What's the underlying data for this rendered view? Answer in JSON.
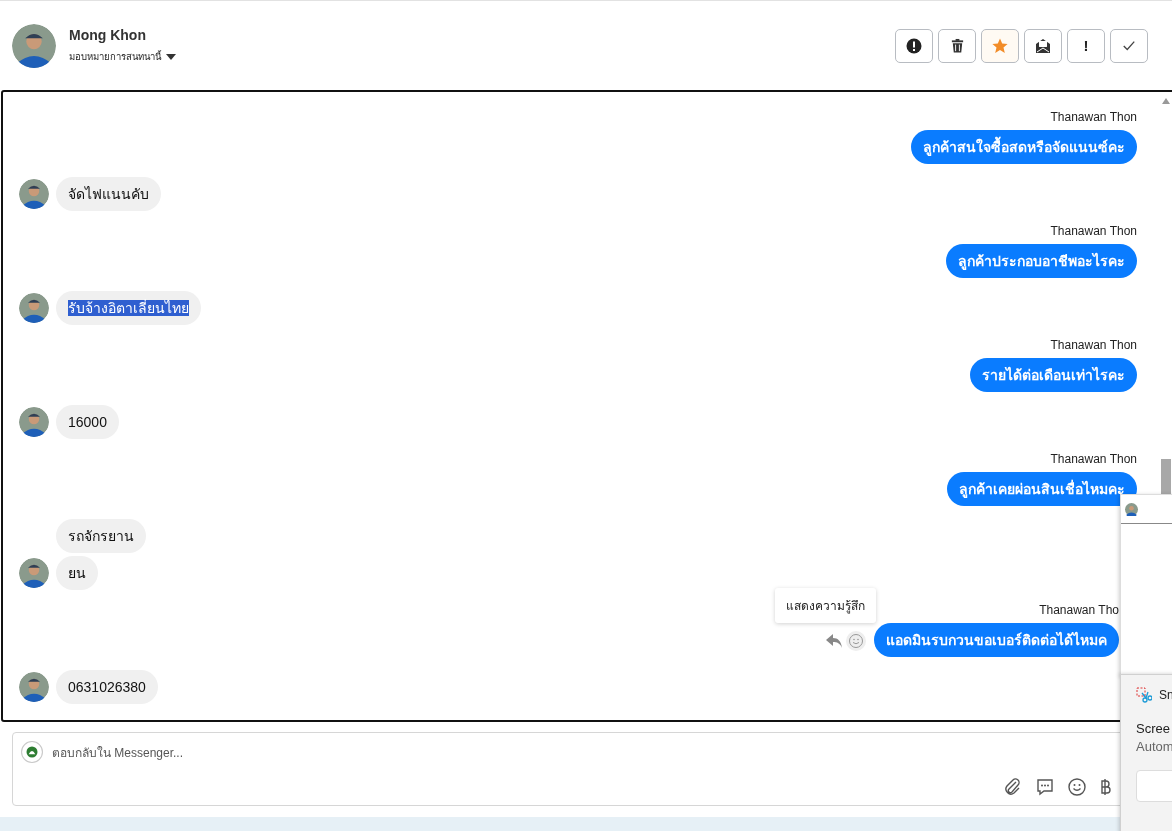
{
  "header": {
    "name": "Mong Khon",
    "assign_label": "มอบหมายการสนทนานี้"
  },
  "toolbar": [
    {
      "kind": "alert",
      "selected": false
    },
    {
      "kind": "trash",
      "selected": false
    },
    {
      "kind": "star",
      "selected": true
    },
    {
      "kind": "mail",
      "selected": false
    },
    {
      "kind": "exclaim",
      "text": "!",
      "selected": false
    },
    {
      "kind": "check",
      "selected": false
    }
  ],
  "messages": [
    {
      "kind": "outgoing",
      "sender": "Thanawan Thon",
      "text": "ลูกค้าสนใจซื้อสดหรือจัดแนนซ์คะ"
    },
    {
      "kind": "incoming",
      "text": "จัดไฟแนนคับ",
      "avatar": true,
      "selected": false
    },
    {
      "kind": "outgoing",
      "sender": "Thanawan Thon",
      "text": "ลูกค้าประกอบอาชีพอะไรคะ"
    },
    {
      "kind": "incoming",
      "text": "รับจ้างอิตาเลี่ยนไทย",
      "avatar": true,
      "selected": true
    },
    {
      "kind": "outgoing",
      "sender": "Thanawan Thon",
      "text": "รายได้ต่อเดือนเท่าไรคะ"
    },
    {
      "kind": "incoming",
      "text": "16000",
      "avatar": true,
      "selected": false
    },
    {
      "kind": "outgoing",
      "sender": "Thanawan Thon",
      "text": "ลูกค้าเคยผ่อนสินเชื่อไหมคะ"
    },
    {
      "kind": "incoming",
      "text": "รถจักรยาน",
      "avatar": false,
      "selected": false
    },
    {
      "kind": "incoming",
      "text": "ยน",
      "avatar": true,
      "selected": false
    },
    {
      "kind": "outgoing",
      "sender": "Thanawan Tho",
      "text": "แอดมินรบกวนขอเบอร์ติดต่อได้ไหมค",
      "tooltip": "แสดงความรู้สึก"
    },
    {
      "kind": "incoming",
      "text": "0631026380",
      "avatar": true,
      "selected": false
    }
  ],
  "composer": {
    "placeholder": "ตอบกลับใน Messenger..."
  },
  "notification": {
    "app": "Sn",
    "title": "Scree",
    "body": "Autom"
  }
}
